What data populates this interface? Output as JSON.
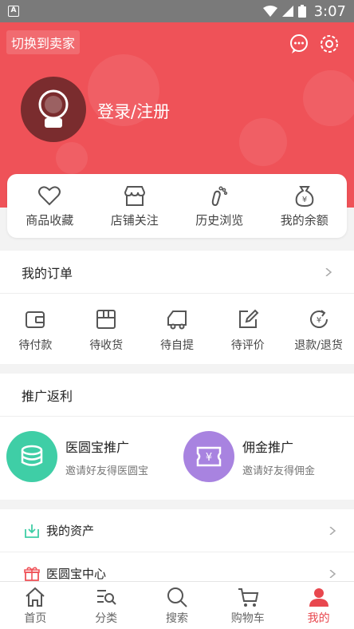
{
  "status_bar": {
    "time": "3:07",
    "indicator": "A"
  },
  "header": {
    "switch_label": "切换到卖家",
    "login_label": "登录/注册",
    "icons": [
      "message-icon",
      "settings-icon"
    ]
  },
  "quick_links": [
    {
      "label": "商品收藏",
      "icon": "heart-icon"
    },
    {
      "label": "店铺关注",
      "icon": "store-icon"
    },
    {
      "label": "历史浏览",
      "icon": "footprint-icon"
    },
    {
      "label": "我的余额",
      "icon": "money-bag-icon"
    }
  ],
  "orders": {
    "title": "我的订单",
    "items": [
      {
        "label": "待付款",
        "icon": "wallet-icon"
      },
      {
        "label": "待收货",
        "icon": "box-icon"
      },
      {
        "label": "待自提",
        "icon": "truck-icon"
      },
      {
        "label": "待评价",
        "icon": "edit-icon"
      },
      {
        "label": "退款/退货",
        "icon": "refund-icon"
      }
    ]
  },
  "promotion": {
    "title": "推广返利",
    "items": [
      {
        "title": "医圆宝推广",
        "subtitle": "邀请好友得医圆宝",
        "color": "#3fcea6",
        "icon": "coins-icon"
      },
      {
        "title": "佣金推广",
        "subtitle": "邀请好友得佣金",
        "color": "#a883e0",
        "icon": "yen-ticket-icon"
      }
    ]
  },
  "menu": [
    {
      "label": "我的资产",
      "icon": "assets-icon"
    },
    {
      "label": "医圆宝中心",
      "icon": "gift-icon"
    }
  ],
  "tabs": [
    {
      "label": "首页",
      "icon": "home-icon",
      "active": false
    },
    {
      "label": "分类",
      "icon": "category-icon",
      "active": false
    },
    {
      "label": "搜索",
      "icon": "search-icon",
      "active": false
    },
    {
      "label": "购物车",
      "icon": "cart-icon",
      "active": false
    },
    {
      "label": "我的",
      "icon": "user-icon",
      "active": true
    }
  ],
  "colors": {
    "brand": "#ef5258",
    "active_tab": "#e8474e"
  }
}
